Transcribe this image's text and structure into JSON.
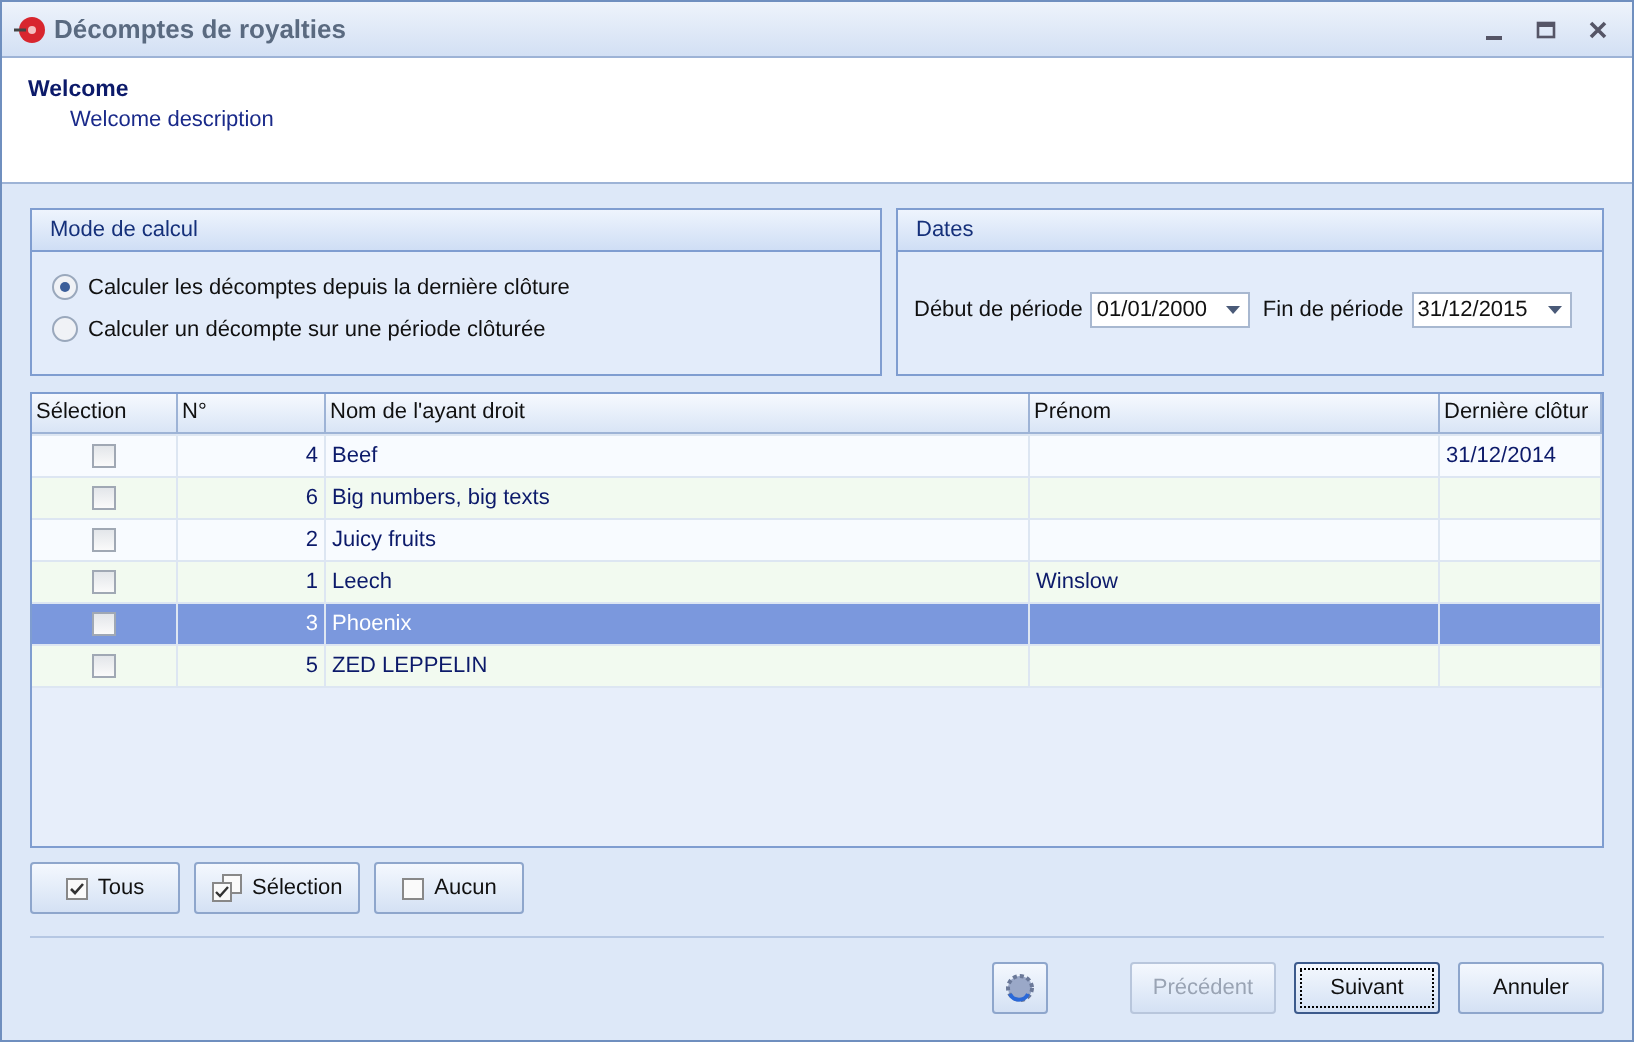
{
  "window": {
    "title": "Décomptes de royalties"
  },
  "header": {
    "title": "Welcome",
    "description": "Welcome description"
  },
  "mode_group": {
    "title": "Mode de calcul",
    "options": [
      {
        "label": "Calculer les décomptes depuis la dernière clôture",
        "selected": true
      },
      {
        "label": "Calculer un décompte sur une période clôturée",
        "selected": false
      }
    ]
  },
  "dates_group": {
    "title": "Dates",
    "fields": [
      {
        "label": "Début de période",
        "value": "01/01/2000"
      },
      {
        "label": "Fin de période",
        "value": "31/12/2015"
      }
    ]
  },
  "table": {
    "columns": [
      "Sélection",
      "N°",
      "Nom de l'ayant droit",
      "Prénom",
      "Dernière clôtur"
    ],
    "rows": [
      {
        "checked": false,
        "selected": false,
        "number": "4",
        "name": "Beef",
        "first_name": "",
        "last_close": "31/12/2014"
      },
      {
        "checked": false,
        "selected": false,
        "number": "6",
        "name": "Big numbers, big texts",
        "first_name": "",
        "last_close": ""
      },
      {
        "checked": false,
        "selected": false,
        "number": "2",
        "name": "Juicy fruits",
        "first_name": "",
        "last_close": ""
      },
      {
        "checked": false,
        "selected": false,
        "number": "1",
        "name": "Leech",
        "first_name": "Winslow",
        "last_close": ""
      },
      {
        "checked": false,
        "selected": true,
        "number": "3",
        "name": "Phoenix",
        "first_name": "",
        "last_close": ""
      },
      {
        "checked": false,
        "selected": false,
        "number": "5",
        "name": "ZED LEPPELIN",
        "first_name": "",
        "last_close": ""
      }
    ]
  },
  "selection_buttons": [
    {
      "label": "Tous",
      "kind": "all"
    },
    {
      "label": "Sélection",
      "kind": "selection"
    },
    {
      "label": "Aucun",
      "kind": "none"
    }
  ],
  "footer_buttons": [
    {
      "label": "Précédent",
      "disabled": true,
      "focused": false
    },
    {
      "label": "Suivant",
      "disabled": false,
      "focused": true
    },
    {
      "label": "Annuler",
      "disabled": false,
      "focused": false
    }
  ]
}
